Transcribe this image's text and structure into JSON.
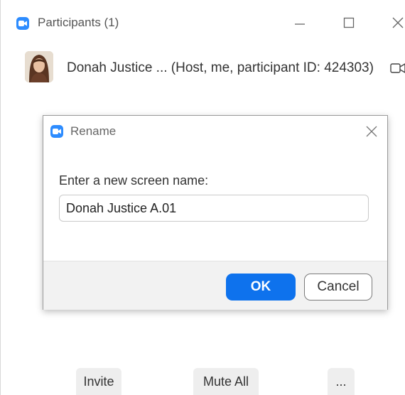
{
  "window": {
    "title": "Participants (1)",
    "icon": "zoom-video-icon",
    "controls": [
      "minimize-icon",
      "maximize-icon",
      "close-icon"
    ]
  },
  "participants": [
    {
      "display": "Donah Justice ... (Host, me, participant ID: 424303)",
      "avatar": "profile-photo",
      "status_icon": "video-camera-icon"
    }
  ],
  "rename_dialog": {
    "title": "Rename",
    "prompt": "Enter a new screen name:",
    "input_value": "Donah Justice A.01",
    "ok_label": "OK",
    "cancel_label": "Cancel"
  },
  "footer_buttons": {
    "invite": "Invite",
    "mute_all": "Mute All",
    "more": "..."
  },
  "colors": {
    "brand_blue": "#2D8CFF",
    "ok_button": "#0E72ED",
    "dialog_footer": "#F2F2F2"
  }
}
